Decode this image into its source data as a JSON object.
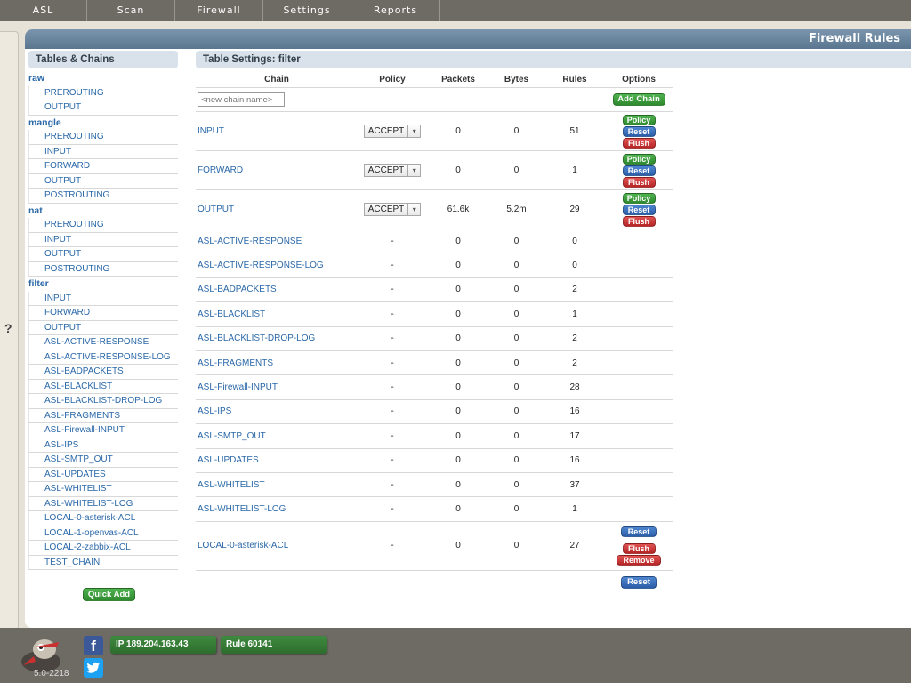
{
  "nav": {
    "items": [
      "ASL",
      "Scan",
      "Firewall",
      "Settings",
      "Reports"
    ]
  },
  "help": {
    "label": "?"
  },
  "panel": {
    "title": "Firewall Rules"
  },
  "left": {
    "heading": "Tables & Chains",
    "tables": [
      {
        "name": "raw",
        "chains": [
          "PREROUTING",
          "OUTPUT"
        ]
      },
      {
        "name": "mangle",
        "chains": [
          "PREROUTING",
          "INPUT",
          "FORWARD",
          "OUTPUT",
          "POSTROUTING"
        ]
      },
      {
        "name": "nat",
        "chains": [
          "PREROUTING",
          "INPUT",
          "OUTPUT",
          "POSTROUTING"
        ]
      },
      {
        "name": "filter",
        "chains": [
          "INPUT",
          "FORWARD",
          "OUTPUT",
          "ASL-ACTIVE-RESPONSE",
          "ASL-ACTIVE-RESPONSE-LOG",
          "ASL-BADPACKETS",
          "ASL-BLACKLIST",
          "ASL-BLACKLIST-DROP-LOG",
          "ASL-FRAGMENTS",
          "ASL-Firewall-INPUT",
          "ASL-IPS",
          "ASL-SMTP_OUT",
          "ASL-UPDATES",
          "ASL-WHITELIST",
          "ASL-WHITELIST-LOG",
          "LOCAL-0-asterisk-ACL",
          "LOCAL-1-openvas-ACL",
          "LOCAL-2-zabbix-ACL",
          "TEST_CHAIN"
        ]
      }
    ],
    "quick_add": "Quick Add"
  },
  "right": {
    "heading": "Table Settings: filter",
    "columns": [
      "Chain",
      "Policy",
      "Packets",
      "Bytes",
      "Rules",
      "Options"
    ],
    "new_chain_placeholder": "<new chain name>",
    "add_chain": "Add Chain",
    "rows": [
      {
        "chain": "INPUT",
        "policy": "ACCEPT",
        "packets": "0",
        "bytes": "0",
        "rules": "51",
        "options": [
          "Policy",
          "Reset",
          "Flush"
        ]
      },
      {
        "chain": "FORWARD",
        "policy": "ACCEPT",
        "packets": "0",
        "bytes": "0",
        "rules": "1",
        "options": [
          "Policy",
          "Reset",
          "Flush"
        ]
      },
      {
        "chain": "OUTPUT",
        "policy": "ACCEPT",
        "packets": "61.6k",
        "bytes": "5.2m",
        "rules": "29",
        "options": [
          "Policy",
          "Reset",
          "Flush"
        ]
      },
      {
        "chain": "ASL-ACTIVE-RESPONSE",
        "policy": "-",
        "packets": "0",
        "bytes": "0",
        "rules": "0",
        "options": []
      },
      {
        "chain": "ASL-ACTIVE-RESPONSE-LOG",
        "policy": "-",
        "packets": "0",
        "bytes": "0",
        "rules": "0",
        "options": []
      },
      {
        "chain": "ASL-BADPACKETS",
        "policy": "-",
        "packets": "0",
        "bytes": "0",
        "rules": "2",
        "options": []
      },
      {
        "chain": "ASL-BLACKLIST",
        "policy": "-",
        "packets": "0",
        "bytes": "0",
        "rules": "1",
        "options": []
      },
      {
        "chain": "ASL-BLACKLIST-DROP-LOG",
        "policy": "-",
        "packets": "0",
        "bytes": "0",
        "rules": "2",
        "options": []
      },
      {
        "chain": "ASL-FRAGMENTS",
        "policy": "-",
        "packets": "0",
        "bytes": "0",
        "rules": "2",
        "options": []
      },
      {
        "chain": "ASL-Firewall-INPUT",
        "policy": "-",
        "packets": "0",
        "bytes": "0",
        "rules": "28",
        "options": []
      },
      {
        "chain": "ASL-IPS",
        "policy": "-",
        "packets": "0",
        "bytes": "0",
        "rules": "16",
        "options": []
      },
      {
        "chain": "ASL-SMTP_OUT",
        "policy": "-",
        "packets": "0",
        "bytes": "0",
        "rules": "17",
        "options": []
      },
      {
        "chain": "ASL-UPDATES",
        "policy": "-",
        "packets": "0",
        "bytes": "0",
        "rules": "16",
        "options": []
      },
      {
        "chain": "ASL-WHITELIST",
        "policy": "-",
        "packets": "0",
        "bytes": "0",
        "rules": "37",
        "options": []
      },
      {
        "chain": "ASL-WHITELIST-LOG",
        "policy": "-",
        "packets": "0",
        "bytes": "0",
        "rules": "1",
        "options": []
      },
      {
        "chain": "LOCAL-0-asterisk-ACL",
        "policy": "-",
        "packets": "0",
        "bytes": "0",
        "rules": "27",
        "options": [
          "Reset",
          "Flush",
          "Remove"
        ]
      }
    ],
    "partial_button": "Reset"
  },
  "footer": {
    "version": "5.0-2218",
    "ip": "IP 189.204.163.43",
    "rule": "Rule 60141",
    "facebook_icon": "facebook-icon",
    "twitter_icon": "twitter-icon"
  },
  "colors": {
    "link": "#2a68a8",
    "nav_bg": "#6e6a64",
    "header_bg": "#5a7690",
    "green": "#2e8a2e",
    "blue": "#2b5ea8",
    "red": "#b62626"
  }
}
